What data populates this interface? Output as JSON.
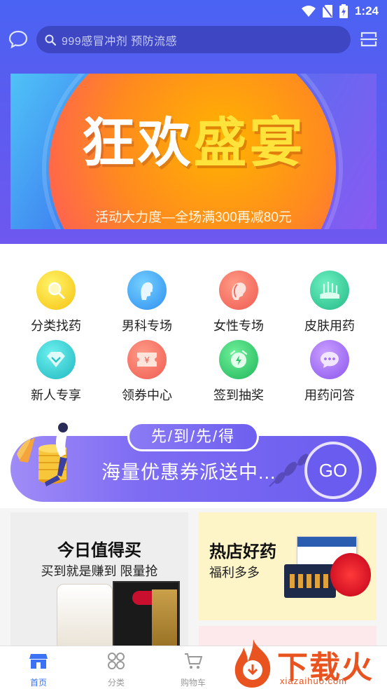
{
  "status_bar": {
    "time": "1:24"
  },
  "search": {
    "placeholder": "999感冒冲剂  预防流感"
  },
  "banner": {
    "title_white": "狂欢",
    "title_yellow": "盛宴",
    "subtitle": "活动大力度—全场满300再减80元"
  },
  "categories": [
    {
      "label": "分类找药",
      "icon": "search-icon",
      "color": "#f9c913"
    },
    {
      "label": "男科专场",
      "icon": "male-head-icon",
      "color": "#3aa6f5"
    },
    {
      "label": "女性专场",
      "icon": "female-head-icon",
      "color": "#f26b5e"
    },
    {
      "label": "皮肤用药",
      "icon": "skin-icon",
      "color": "#2fc99a"
    },
    {
      "label": "新人专享",
      "icon": "diamond-icon",
      "color": "#29c6c7"
    },
    {
      "label": "领券中心",
      "icon": "coupon-icon",
      "color": "#f57160"
    },
    {
      "label": "签到抽奖",
      "icon": "alarm-clock-icon",
      "color": "#2fc66c"
    },
    {
      "label": "用药问答",
      "icon": "chat-bubble-icon",
      "color": "#a46cf2"
    }
  ],
  "promo": {
    "tag": "先/到/先/得",
    "text": "海量优惠券派送中...",
    "button": "GO"
  },
  "cards": {
    "left": {
      "title": "今日值得买",
      "subtitle": "买到就是赚到 限量抢"
    },
    "right": {
      "title": "热店好药",
      "subtitle": "福利多多"
    }
  },
  "bottom_nav": [
    {
      "label": "首页",
      "icon": "home-icon",
      "active": true
    },
    {
      "label": "分类",
      "icon": "category-icon",
      "active": false
    },
    {
      "label": "购物车",
      "icon": "cart-icon",
      "active": false
    }
  ],
  "watermark": {
    "text": "下载火",
    "url": "xiazaihuo.com"
  },
  "colors": {
    "accent": "#4a63f2",
    "active_nav": "#3b72f3"
  }
}
